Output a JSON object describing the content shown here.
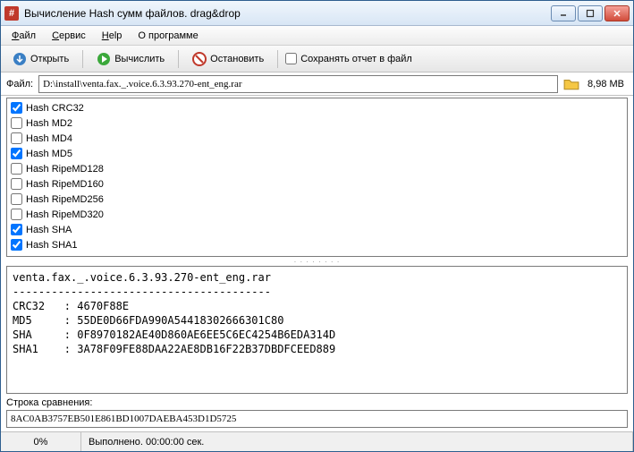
{
  "title": "Вычисление Hash сумм файлов.  drag&drop",
  "menu": {
    "file": "Файл",
    "service": "Сервис",
    "help": "Help",
    "about": "О программе"
  },
  "toolbar": {
    "open": "Открыть",
    "compute": "Вычислить",
    "stop": "Остановить",
    "save_report": "Сохранять отчет в файл"
  },
  "file": {
    "label": "Файл:",
    "path": "D:\\install\\venta.fax._.voice.6.3.93.270-ent_eng.rar",
    "size": "8,98 MB"
  },
  "hashes": [
    {
      "label": "Hash CRC32",
      "checked": true
    },
    {
      "label": "Hash MD2",
      "checked": false
    },
    {
      "label": "Hash MD4",
      "checked": false
    },
    {
      "label": "Hash MD5",
      "checked": true
    },
    {
      "label": "Hash RipeMD128",
      "checked": false
    },
    {
      "label": "Hash RipeMD160",
      "checked": false
    },
    {
      "label": "Hash RipeMD256",
      "checked": false
    },
    {
      "label": "Hash RipeMD320",
      "checked": false
    },
    {
      "label": "Hash SHA",
      "checked": true
    },
    {
      "label": "Hash SHA1",
      "checked": true
    }
  ],
  "output": {
    "line0": "venta.fax._.voice.6.3.93.270-ent_eng.rar",
    "line1": "----------------------------------------",
    "line2": "CRC32   : 4670F88E",
    "line3": "MD5     : 55DE0D66FDA990A54418302666301C80",
    "line4": "SHA     : 0F8970182AE40D860AE6EE5C6EC4254B6EDA314D",
    "line5": "SHA1    : 3A78F09FE88DAA22AE8DB16F22B37DBDFCEED889"
  },
  "compare": {
    "label": "Строка сравнения:",
    "value": "8AC0AB3757EB501E861BD1007DAEBA453D1D5725"
  },
  "status": {
    "percent": "0%",
    "text": "Выполнено. 00:00:00 сек."
  }
}
